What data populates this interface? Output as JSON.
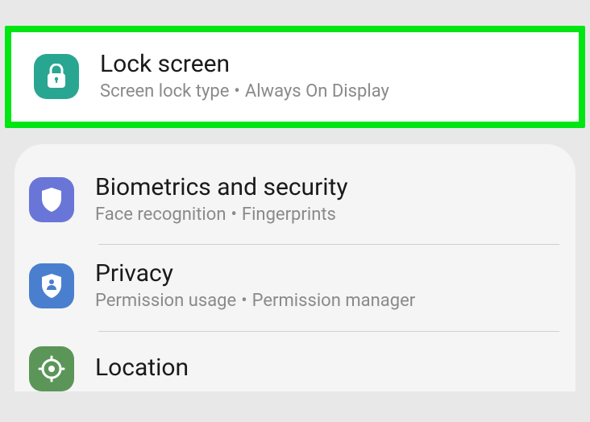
{
  "highlight": {
    "title": "Lock screen",
    "sub1": "Screen lock type",
    "sub2": "Always On Display",
    "iconColor": "#28a692",
    "highlightBorder": "#00e612"
  },
  "group": [
    {
      "id": "biometrics",
      "title": "Biometrics and security",
      "sub1": "Face recognition",
      "sub2": "Fingerprints",
      "iconClass": "icon-purple"
    },
    {
      "id": "privacy",
      "title": "Privacy",
      "sub1": "Permission usage",
      "sub2": "Permission manager",
      "iconClass": "icon-blue"
    },
    {
      "id": "location",
      "title": "Location",
      "sub1": "",
      "sub2": "",
      "iconClass": "icon-green"
    }
  ],
  "separator": "•"
}
